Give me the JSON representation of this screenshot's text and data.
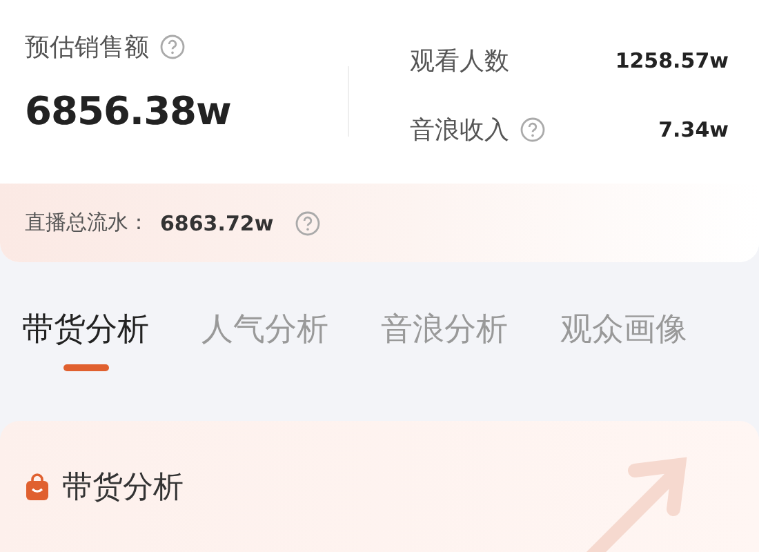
{
  "summary": {
    "main_metric": {
      "label": "预估销售额",
      "value": "6856.38w",
      "help": true
    },
    "side_metrics": [
      {
        "label": "观看人数",
        "value": "1258.57w",
        "help": false
      },
      {
        "label": "音浪收入",
        "value": "7.34w",
        "help": true
      }
    ],
    "total": {
      "label": "直播总流水：",
      "value": "6863.72w",
      "help": true
    }
  },
  "tabs": [
    {
      "label": "带货分析",
      "selected": true
    },
    {
      "label": "人气分析",
      "selected": false
    },
    {
      "label": "音浪分析",
      "selected": false
    },
    {
      "label": "观众画像",
      "selected": false
    }
  ],
  "section": {
    "title": "带货分析"
  }
}
